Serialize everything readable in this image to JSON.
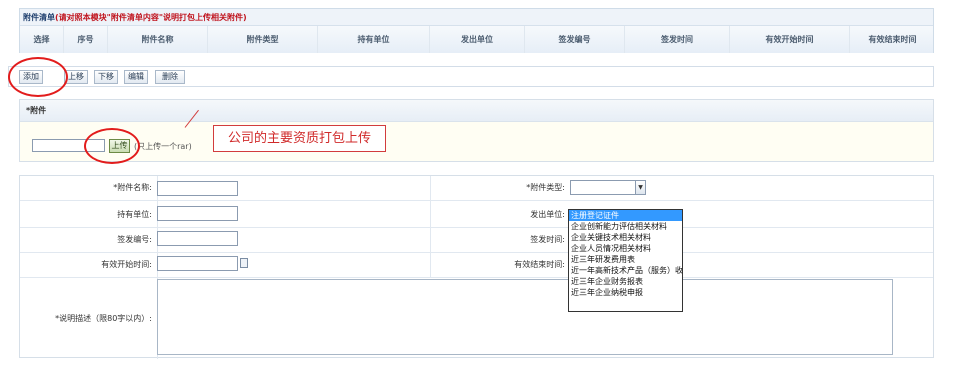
{
  "list": {
    "title_prefix": "附件清单",
    "title_note": "(请对照本模块\"附件清单内容\"说明打包上传相关附件)",
    "columns": [
      "选择",
      "序号",
      "附件名称",
      "附件类型",
      "持有单位",
      "发出单位",
      "签发编号",
      "签发时间",
      "有效开始时间",
      "有效结束时间"
    ]
  },
  "toolbar": {
    "add": "添加",
    "move_up": "上移",
    "move_down": "下移",
    "edit": "编辑",
    "delete": "删除"
  },
  "upload": {
    "section_title": "*附件",
    "file_value": "",
    "button": "上传",
    "note": "(只上传一个rar)"
  },
  "annotation": {
    "text": "公司的主要资质打包上传"
  },
  "form": {
    "name_label": "*附件名称:",
    "type_label": "*附件类型:",
    "holder_label": "持有单位:",
    "issuer_label": "发出单位:",
    "code_label": "签发编号:",
    "issue_time_label": "签发时间:",
    "start_label": "有效开始时间:",
    "end_label": "有效结束时间:",
    "desc_label": "*说明描述（限80字以内）:",
    "type_value": ""
  },
  "dropdown": {
    "options": [
      "注册登记证件",
      "企业创新能力评估相关材料",
      "企业关键技术相关材料",
      "企业人员情况相关材料",
      "近三年研发费用表",
      "近一年高新技术产品（服务）收入表",
      "近三年企业财务报表",
      "近三年企业纳税申报"
    ],
    "selected": "注册登记证件"
  },
  "colors": {
    "annotation_red": "#e21c1c",
    "selection_blue": "#3399ff",
    "header_blue": "#1f3f6e"
  }
}
